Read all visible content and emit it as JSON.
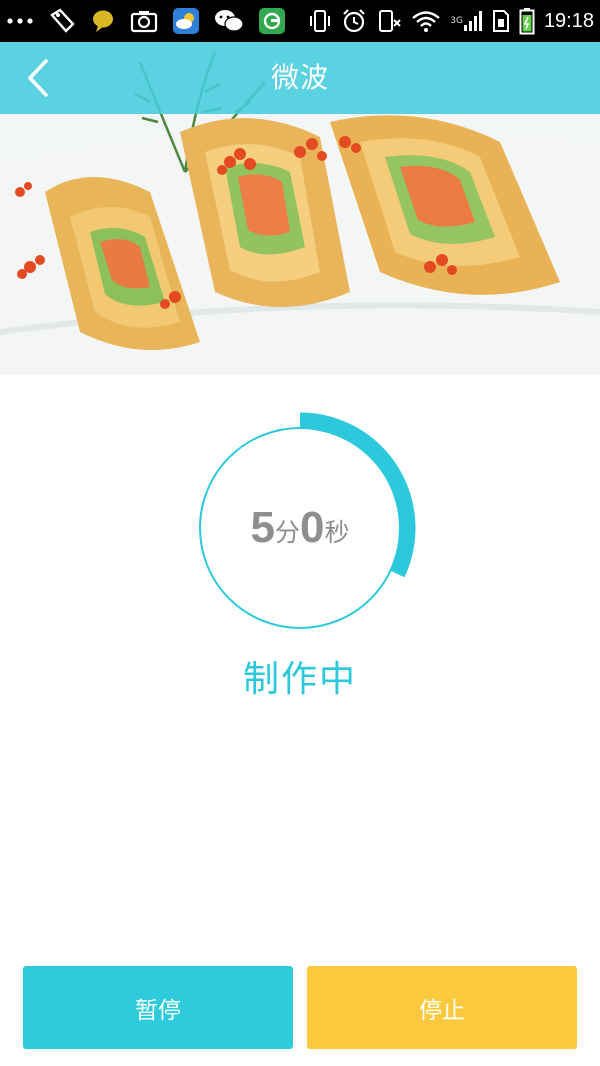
{
  "status_bar": {
    "time": "19:18",
    "network": "3G",
    "icons_left": [
      "overflow-dots-icon",
      "tag-icon",
      "chat-bubble-icon",
      "camera-icon",
      "weather-icon",
      "wechat-icon",
      "app-icon"
    ],
    "icons_right": [
      "vibrate-icon",
      "alarm-icon",
      "phone-muted-icon",
      "wifi-icon",
      "signal-icon",
      "sim-icon",
      "battery-icon"
    ]
  },
  "header": {
    "title": "微波",
    "back_icon": "chevron-left-icon"
  },
  "timer": {
    "minutes": "5",
    "minutes_unit": "分",
    "seconds": "0",
    "seconds_unit": "秒",
    "progress": 0.32
  },
  "status": {
    "label": "制作中"
  },
  "buttons": {
    "pause": "暂停",
    "stop": "停止"
  },
  "colors": {
    "accent": "#2dcbdc",
    "header_bg": "#46cdde",
    "stop_button": "#fbc93d",
    "timer_text": "#8e8e8e",
    "ring_track": "#2cc9dc"
  }
}
